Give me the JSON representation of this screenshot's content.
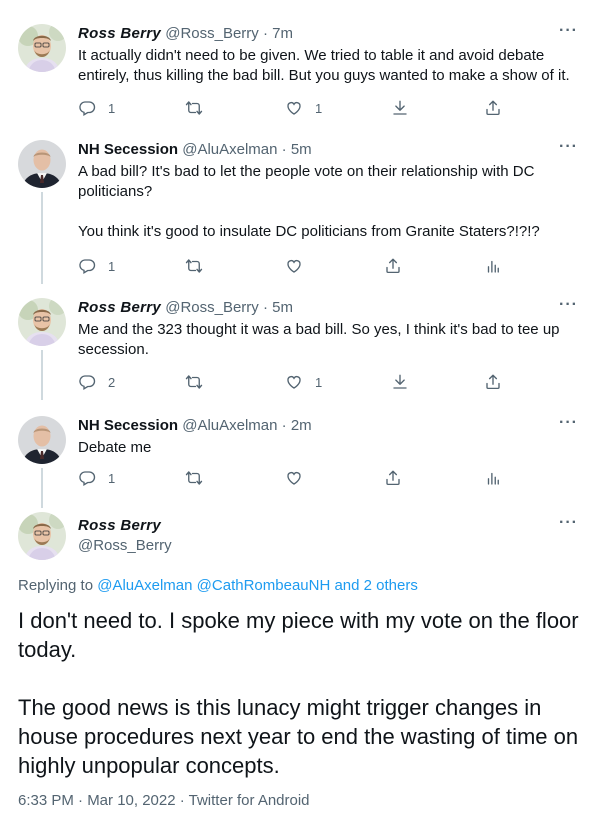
{
  "tweets": [
    {
      "name": "Ross Berry",
      "handle": "@Ross_Berry",
      "time": "· 7m",
      "text": "It actually didn't need to be given. We tried to table it and avoid debate entirely, thus killing the bad bill. But you guys wanted to make a show of it.",
      "reply_count": "1",
      "like_count": "1"
    },
    {
      "name": "NH Secession",
      "handle": "@AluAxelman",
      "time": "· 5m",
      "text_1": "A bad bill? It's bad to let the people vote on their relationship with DC politicians?",
      "text_2": "You think it's good to insulate DC politicians from Granite Staters?!?!?",
      "reply_count": "1"
    },
    {
      "name": "Ross Berry",
      "handle": "@Ross_Berry",
      "time": "· 5m",
      "text": "Me and the 323 thought it was a bad bill. So yes, I think it's bad to tee up secession.",
      "reply_count": "2",
      "like_count": "1"
    },
    {
      "name": "NH Secession",
      "handle": "@AluAxelman",
      "time": "· 2m",
      "text": "Debate me",
      "reply_count": "1"
    }
  ],
  "main_tweet": {
    "name": "Ross Berry",
    "handle": "@Ross_Berry",
    "replying_prefix": "Replying to",
    "replying_to_1": "@AluAxelman",
    "replying_to_2": "@CathRombeauNH",
    "replying_and": "and 2 others",
    "text_1": "I don't need to. I spoke my piece with my vote on the floor today.",
    "text_2": "The good news is this lunacy might trigger changes in house procedures next year to end the wasting of time on highly unpopular concepts.",
    "timestamp": "6:33 PM · Mar 10, 2022 · Twitter for Android"
  },
  "more_label": "···",
  "colors": {
    "text": "#0f1419",
    "muted": "#536471",
    "link": "#1d9bf0",
    "thread_line": "#cfd9de"
  },
  "icons": {
    "reply": "reply-icon",
    "retweet": "retweet-icon",
    "like": "heart-icon",
    "share": "share-icon",
    "download": "download-icon",
    "analytics": "analytics-icon",
    "more": "more-icon"
  }
}
